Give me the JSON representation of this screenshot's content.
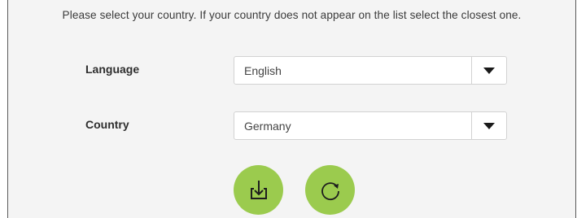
{
  "instruction": "Please select your country. If your country does not appear on the list select the closest one.",
  "language": {
    "label": "Language",
    "value": "English",
    "dropdown_icon": "triangle-down-icon"
  },
  "country": {
    "label": "Country",
    "value": "Germany",
    "dropdown_icon": "triangle-down-icon"
  },
  "buttons": [
    {
      "icon": "download-icon"
    },
    {
      "icon": "refresh-icon"
    }
  ],
  "colors": {
    "panel_background": "#f4f4f4",
    "button_green": "#9bcb4e",
    "icon_stroke": "#1e1e1e"
  }
}
